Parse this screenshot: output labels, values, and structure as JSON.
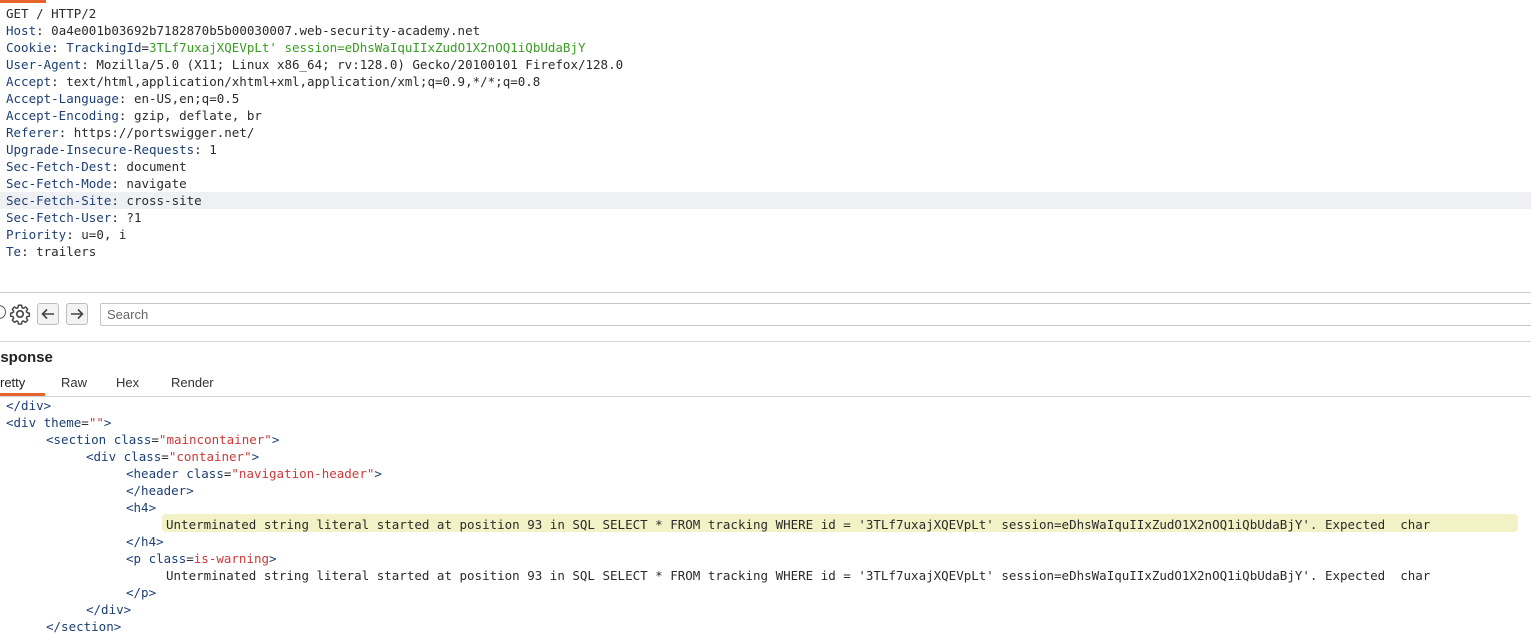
{
  "request": {
    "lines": [
      {
        "name": "",
        "value": "GET / HTTP/2"
      },
      {
        "name": "Host",
        "value": "0a4e001b03692b7182870b5b00030007.web-security-academy.net"
      },
      {
        "name": "Cookie",
        "cookie_name": "TrackingId",
        "cookie_value": "3TLf7uxajXQEVpLt' session=eDhsWaIquIIxZudO1X2nOQ1iQbUdaBjY"
      },
      {
        "name": "User-Agent",
        "value": "Mozilla/5.0 (X11; Linux x86_64; rv:128.0) Gecko/20100101 Firefox/128.0"
      },
      {
        "name": "Accept",
        "value": "text/html,application/xhtml+xml,application/xml;q=0.9,*/*;q=0.8"
      },
      {
        "name": "Accept-Language",
        "value": "en-US,en;q=0.5"
      },
      {
        "name": "Accept-Encoding",
        "value": "gzip, deflate, br"
      },
      {
        "name": "Referer",
        "value": "https://portswigger.net/"
      },
      {
        "name": "Upgrade-Insecure-Requests",
        "value": "1"
      },
      {
        "name": "Sec-Fetch-Dest",
        "value": "document"
      },
      {
        "name": "Sec-Fetch-Mode",
        "value": "navigate"
      },
      {
        "name": "Sec-Fetch-Site",
        "value": "cross-site"
      },
      {
        "name": "Sec-Fetch-User",
        "value": "?1"
      },
      {
        "name": "Priority",
        "value": "u=0, i"
      },
      {
        "name": "Te",
        "value": "trailers"
      }
    ]
  },
  "toolbar": {
    "search_placeholder": "Search"
  },
  "response": {
    "title": "esponse",
    "tabs": [
      {
        "label": "retty"
      },
      {
        "label": "Raw"
      },
      {
        "label": "Hex"
      },
      {
        "label": "Render"
      }
    ],
    "code": {
      "l1": "</div>",
      "l2_tag_open": "<div",
      "l2_attr": "theme",
      "l2_str": "\"\"",
      "l2_close": ">",
      "l3_tag_open": "<section",
      "l3_attr": "class",
      "l3_str": "\"maincontainer\"",
      "l3_close": ">",
      "l4_tag_open": "<div",
      "l4_attr": "class",
      "l4_str": "\"container\"",
      "l4_close": ">",
      "l5_tag_open": "<header",
      "l5_attr": "class",
      "l5_str": "\"navigation-header\"",
      "l5_close": ">",
      "l6": "</header>",
      "l7": "<h4>",
      "l8": "Unterminated string literal started at position 93 in SQL SELECT * FROM tracking WHERE id = '3TLf7uxajXQEVpLt' session=eDhsWaIquIIxZudO1X2nOQ1iQbUdaBjY'. Expected  char",
      "l9": "</h4>",
      "l10_tag_open": "<p",
      "l10_attr": "class",
      "l10_str": "is-warning",
      "l10_close": ">",
      "l11": "Unterminated string literal started at position 93 in SQL SELECT * FROM tracking WHERE id = '3TLf7uxajXQEVpLt' session=eDhsWaIquIIxZudO1X2nOQ1iQbUdaBjY'. Expected  char",
      "l12": "</p>",
      "l13": "</div>",
      "l14": "</section>"
    }
  },
  "colors": {
    "accent": "#e8622c",
    "header_name": "#1d3f73",
    "cookie_value": "#3a9d23",
    "string": "#c83b3b",
    "highlight": "#f3f2c6"
  }
}
